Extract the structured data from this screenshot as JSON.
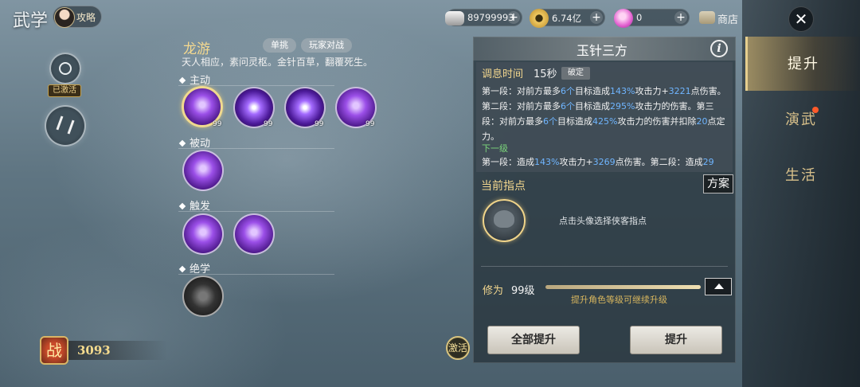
{
  "header": {
    "title": "武学",
    "guide_label": "攻略"
  },
  "currencies": [
    {
      "icon": "silver-ingot-icon",
      "value": "89799993"
    },
    {
      "icon": "coin-icon",
      "value": "6.74亿"
    },
    {
      "icon": "pink-gem-icon",
      "value": "0"
    }
  ],
  "shop_label": "商店",
  "right_nav": {
    "items": [
      {
        "label": "提升",
        "active": true
      },
      {
        "label": "演武",
        "active": false,
        "badge": true
      },
      {
        "label": "生活",
        "active": false
      }
    ]
  },
  "left_panel": {
    "activated_label": "已激活"
  },
  "skill_tree": {
    "school_name": "龙游",
    "tags": [
      "单挑",
      "玩家对战"
    ],
    "motto": "天人相应，素问灵枢。金针百草，翻覆死生。",
    "sections": {
      "active": "主动",
      "passive": "被动",
      "trigger": "触发",
      "ultimate": "绝学"
    },
    "active_skill_levels": [
      "99",
      "99",
      "99",
      "99"
    ]
  },
  "combat_power": {
    "value": "3093",
    "icon_glyph": "战"
  },
  "awaken_glyph": "激活",
  "detail": {
    "title": "玉针三方",
    "cooldown_label": "调息时间",
    "cooldown_value": "15秒",
    "tag": "破定",
    "desc_parts": {
      "p1": "第一段：对前方最多",
      "n1": "6个",
      "p2": "目标造成",
      "n2": "143%",
      "p3": "攻击力+",
      "n3": "3221",
      "p4": "点伤害。第二段：对前方最多",
      "n4": "6个",
      "p5": "目标造成",
      "n5": "295%",
      "p6": "攻击力的伤害。第三段：对前方最多",
      "n6": "6个",
      "p7": "目标造成",
      "n7": "425%",
      "p8": "攻击力的伤害并扣除",
      "n8": "20",
      "p9": "点定力。"
    },
    "next_level_label": "下一级",
    "next_parts": {
      "p1": "第一段：造成",
      "n1": "143%",
      "p2": "攻击力+",
      "n2": "3269",
      "p3": "点伤害。第二段：造成",
      "n3": "29"
    },
    "guidance_label": "当前指点",
    "scheme_label": "方案",
    "guidance_hint": "点击头像选择侠客指点",
    "cultivation_label": "修为",
    "cultivation_level": "99级",
    "cultivation_progress": 1.0,
    "cultivation_hint": "提升角色等级可继续升级",
    "btn_all": "全部提升",
    "btn_upgrade": "提升"
  }
}
